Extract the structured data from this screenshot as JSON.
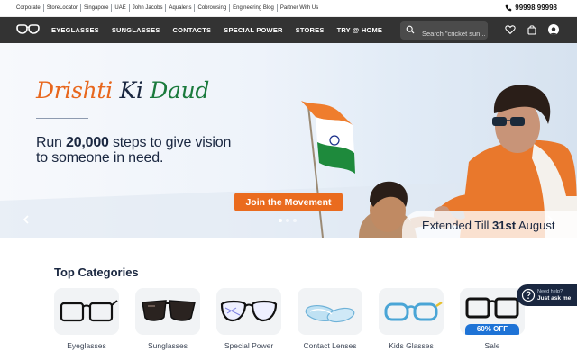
{
  "top_links": [
    "Corporate",
    "StoreLocator",
    "Singapore",
    "UAE",
    "John Jacobs",
    "Aqualens",
    "Cobrowsing",
    "Engineering Blog",
    "Partner With Us"
  ],
  "phone": {
    "icon": "phone-icon",
    "number": "99998 99998"
  },
  "nav": {
    "logo": "lenskart-glasses-logo",
    "items": [
      "EYEGLASSES",
      "SUNGLASSES",
      "CONTACTS",
      "SPECIAL POWER",
      "STORES",
      "TRY @ HOME"
    ],
    "search_placeholder": "Search \"cricket sun...",
    "icons": [
      "heart-icon",
      "shopping-bag-icon",
      "user-avatar-icon"
    ]
  },
  "hero": {
    "title_part1": "Drishti",
    "title_part2": "Ki",
    "title_part3": "Daud",
    "subtitle_pre": "Run ",
    "subtitle_bold": "20,000",
    "subtitle_post": " steps to give vision to someone in need.",
    "cta": "Join the Movement",
    "extended_pre": "Extended Till ",
    "extended_bold": "31st",
    "extended_post": " August",
    "slide_count": 3,
    "active_slide": 1
  },
  "categories": {
    "title": "Top Categories",
    "items": [
      {
        "label": "Eyeglasses",
        "icon": "eyeglasses-icon"
      },
      {
        "label": "Sunglasses",
        "icon": "sunglasses-icon"
      },
      {
        "label": "Special Power",
        "icon": "special-power-glasses-icon"
      },
      {
        "label": "Contact Lenses",
        "icon": "contact-lenses-icon"
      },
      {
        "label": "Kids Glasses",
        "icon": "kids-glasses-icon"
      },
      {
        "label": "Sale",
        "icon": "sale-glasses-icon",
        "badge": "60% OFF"
      }
    ]
  },
  "help": {
    "line1": "Need help?",
    "line2": "Just ask me"
  },
  "colors": {
    "accent": "#ea6b1e",
    "navy": "#1a2740",
    "nav_bg": "#333333",
    "sale_blue": "#1e73d6"
  }
}
